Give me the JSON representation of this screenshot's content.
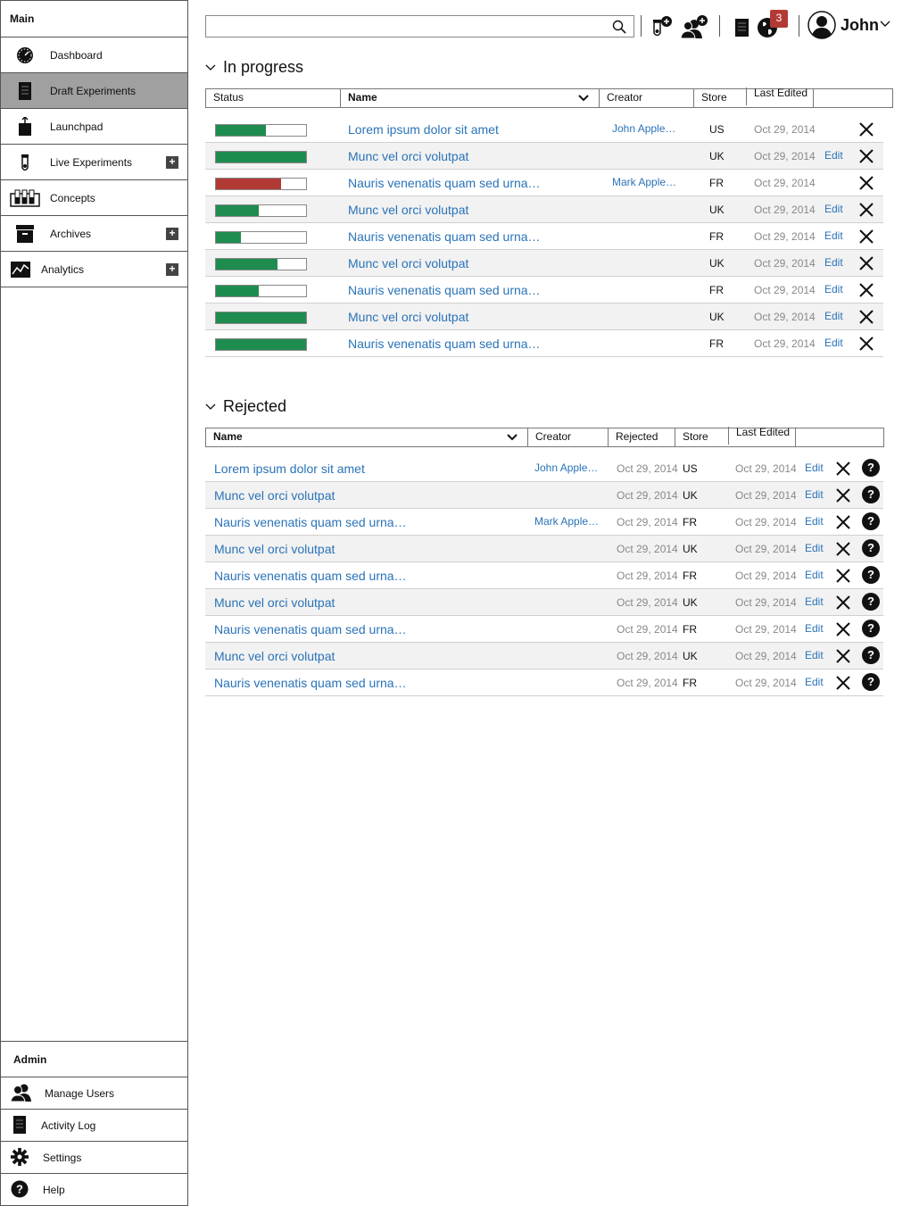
{
  "sidebar": {
    "main_title": "Main",
    "items": [
      {
        "label": "Dashboard",
        "icon": "dashboard-gauge-icon",
        "active": false,
        "plus": false
      },
      {
        "label": "Draft Experiments",
        "icon": "document-icon",
        "active": true,
        "plus": false
      },
      {
        "label": "Launchpad",
        "icon": "launchpad-icon",
        "active": false,
        "plus": false
      },
      {
        "label": "Live Experiments",
        "icon": "test-tube-icon",
        "active": false,
        "plus": true
      },
      {
        "label": "Concepts",
        "icon": "test-tubes-rack-icon",
        "active": false,
        "plus": false
      },
      {
        "label": "Archives",
        "icon": "archive-box-icon",
        "active": false,
        "plus": true
      },
      {
        "label": "Analytics",
        "icon": "analytics-chart-icon",
        "active": false,
        "plus": true
      }
    ],
    "plus_label": "+",
    "admin_title": "Admin",
    "admin_items": [
      {
        "label": "Manage Users",
        "icon": "users-icon"
      },
      {
        "label": "Activity Log",
        "icon": "log-icon"
      },
      {
        "label": "Settings",
        "icon": "gear-icon"
      },
      {
        "label": "Help",
        "icon": "help-icon"
      }
    ]
  },
  "header": {
    "search_value": "",
    "search_placeholder": "",
    "notification_count": "3",
    "user_name": "John"
  },
  "colors": {
    "link": "#2a73b8",
    "progress_green": "#1f8c4f",
    "progress_red": "#b23a35",
    "active_nav": "#a0a0a0"
  },
  "in_progress": {
    "title": "In progress",
    "headers": {
      "status": "Status",
      "name": "Name",
      "creator": "Creator",
      "store": "Store",
      "last_edited": "Last Edited"
    },
    "rows": [
      {
        "name": "Lorem ipsum dolor sit amet",
        "creator": "John Apple…",
        "store": "US",
        "date": "Oct 29, 2014",
        "edit": "",
        "progress": 0.55,
        "color": "green"
      },
      {
        "name": "Munc vel orci volutpat",
        "creator": "",
        "store": "UK",
        "date": "Oct 29, 2014",
        "edit": "Edit",
        "progress": 1.0,
        "color": "green"
      },
      {
        "name": "Nauris venenatis quam sed urna…",
        "creator": "Mark Apple…",
        "store": "FR",
        "date": "Oct 29, 2014",
        "edit": "",
        "progress": 0.72,
        "color": "red"
      },
      {
        "name": "Munc vel orci volutpat",
        "creator": "",
        "store": "UK",
        "date": "Oct 29, 2014",
        "edit": "Edit",
        "progress": 0.48,
        "color": "green"
      },
      {
        "name": "Nauris venenatis quam sed urna…",
        "creator": "",
        "store": "FR",
        "date": "Oct 29, 2014",
        "edit": "Edit",
        "progress": 0.28,
        "color": "green"
      },
      {
        "name": "Munc vel orci volutpat",
        "creator": "",
        "store": "UK",
        "date": "Oct 29, 2014",
        "edit": "Edit",
        "progress": 0.68,
        "color": "green"
      },
      {
        "name": "Nauris venenatis quam sed urna…",
        "creator": "",
        "store": "FR",
        "date": "Oct 29, 2014",
        "edit": "Edit",
        "progress": 0.48,
        "color": "green"
      },
      {
        "name": "Munc vel orci volutpat",
        "creator": "",
        "store": "UK",
        "date": "Oct 29, 2014",
        "edit": "Edit",
        "progress": 1.0,
        "color": "green"
      },
      {
        "name": "Nauris venenatis quam sed urna…",
        "creator": "",
        "store": "FR",
        "date": "Oct 29, 2014",
        "edit": "Edit",
        "progress": 1.0,
        "color": "green"
      }
    ]
  },
  "rejected": {
    "title": "Rejected",
    "headers": {
      "name": "Name",
      "creator": "Creator",
      "rejected": "Rejected",
      "store": "Store",
      "last_edited": "Last Edited"
    },
    "help_label": "?",
    "rows": [
      {
        "name": "Lorem ipsum dolor sit amet",
        "creator": "John Apple…",
        "rejected": "Oct 29, 2014",
        "store": "US",
        "date": "Oct 29, 2014",
        "edit": "Edit"
      },
      {
        "name": "Munc vel orci volutpat",
        "creator": "",
        "rejected": "Oct 29, 2014",
        "store": "UK",
        "date": "Oct 29, 2014",
        "edit": "Edit"
      },
      {
        "name": "Nauris venenatis quam sed urna…",
        "creator": "Mark Apple…",
        "rejected": "Oct 29, 2014",
        "store": "FR",
        "date": "Oct 29, 2014",
        "edit": "Edit"
      },
      {
        "name": "Munc vel orci volutpat",
        "creator": "",
        "rejected": "Oct 29, 2014",
        "store": "UK",
        "date": "Oct 29, 2014",
        "edit": "Edit"
      },
      {
        "name": "Nauris venenatis quam sed urna…",
        "creator": "",
        "rejected": "Oct 29, 2014",
        "store": "FR",
        "date": "Oct 29, 2014",
        "edit": "Edit"
      },
      {
        "name": "Munc vel orci volutpat",
        "creator": "",
        "rejected": "Oct 29, 2014",
        "store": "UK",
        "date": "Oct 29, 2014",
        "edit": "Edit"
      },
      {
        "name": "Nauris venenatis quam sed urna…",
        "creator": "",
        "rejected": "Oct 29, 2014",
        "store": "FR",
        "date": "Oct 29, 2014",
        "edit": "Edit"
      },
      {
        "name": "Munc vel orci volutpat",
        "creator": "",
        "rejected": "Oct 29, 2014",
        "store": "UK",
        "date": "Oct 29, 2014",
        "edit": "Edit"
      },
      {
        "name": "Nauris venenatis quam sed urna…",
        "creator": "",
        "rejected": "Oct 29, 2014",
        "store": "FR",
        "date": "Oct 29, 2014",
        "edit": "Edit"
      }
    ]
  }
}
